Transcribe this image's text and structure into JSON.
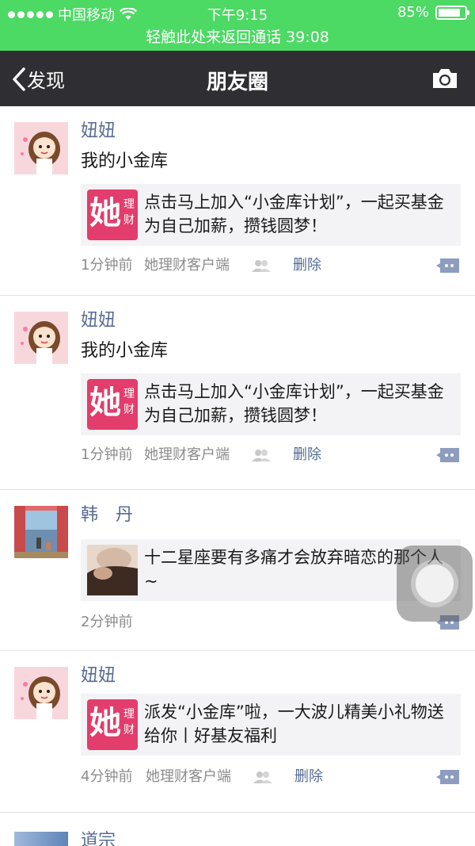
{
  "status_bar": {
    "carrier": "中国移动",
    "time": "下午9:15",
    "battery": "85%",
    "battery_level": 0.85,
    "call_banner": "轻触此处来返回通话  39:08"
  },
  "nav": {
    "back_label": "发现",
    "title": "朋友圈"
  },
  "posts": [
    {
      "name": "妞妞",
      "text": "我的小金库",
      "card_text": "点击马上加入“小金库计划”，一起买基金为自己加薪，攒钱圆梦！",
      "brand_big": "她",
      "brand_small": "理财",
      "time": "1分钟前",
      "source": "她理财客户端",
      "delete": "删除"
    },
    {
      "name": "妞妞",
      "text": "我的小金库",
      "card_text": "点击马上加入“小金库计划”，一起买基金为自己加薪，攒钱圆梦！",
      "brand_big": "她",
      "brand_small": "理财",
      "time": "1分钟前",
      "source": "她理财客户端",
      "delete": "删除"
    },
    {
      "name": "韩　丹",
      "card_text": "十二星座要有多痛才会放弃暗恋的那个人~",
      "time": "2分钟前"
    },
    {
      "name": "妞妞",
      "card_text": "派发“小金库”啦，一大波儿精美小礼物送给你丨好基友福利",
      "brand_big": "她",
      "brand_small": "理财",
      "time": "4分钟前",
      "source": "她理财客户端",
      "delete": "删除"
    },
    {
      "name": "道宗"
    }
  ],
  "colors": {
    "status_green": "#4cd964",
    "nav_dark": "#2f2f33",
    "link_blue": "#576b95",
    "brand_pink": "#e23d6c"
  }
}
